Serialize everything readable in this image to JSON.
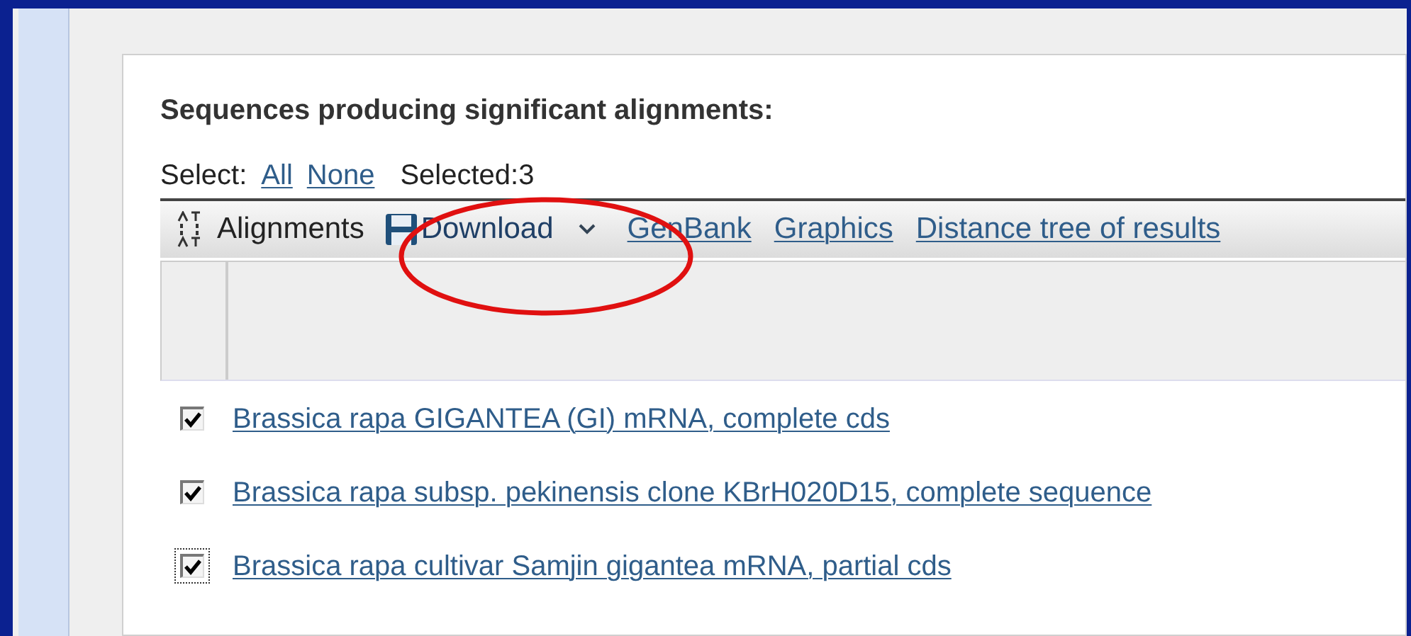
{
  "heading": "Sequences producing significant alignments:",
  "select": {
    "label": "Select:",
    "links": [
      "All",
      "None"
    ],
    "selected_count": "Selected:3"
  },
  "toolbar": {
    "alignments": "Alignments",
    "download": "Download",
    "links": [
      "GenBank",
      "Graphics",
      "Distance tree of results"
    ]
  },
  "annotation": {
    "kind": "ellipse",
    "color": "#e01010"
  },
  "rows": [
    {
      "title": "Brassica rapa GIGANTEA (GI) mRNA, complete cds",
      "checked": true,
      "focused": false
    },
    {
      "title": "Brassica rapa subsp. pekinensis clone KBrH020D15, complete sequence",
      "checked": true,
      "focused": false
    },
    {
      "title": "Brassica rapa cultivar Samjin gigantea mRNA, partial cds",
      "checked": true,
      "focused": true
    }
  ]
}
